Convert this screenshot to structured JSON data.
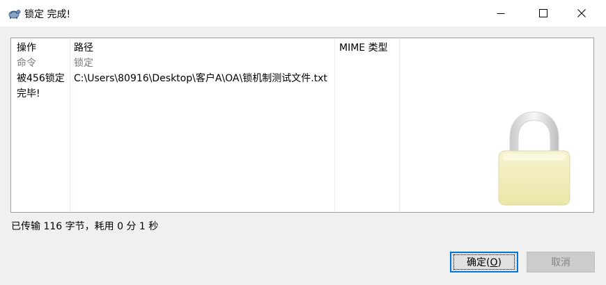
{
  "window": {
    "title": "锁定 完成!",
    "app_icon": "tortoise-icon"
  },
  "table": {
    "columns": [
      "操作",
      "路径",
      "MIME 类型"
    ],
    "rows": [
      {
        "action": "命令",
        "path": "锁定",
        "mime": "",
        "style": "gray"
      },
      {
        "action": "被456锁定完毕!",
        "path": "C:\\Users\\80916\\Desktop\\客户A\\OA\\锁机制测试文件.txt",
        "mime": ""
      }
    ]
  },
  "status": "已传输 116 字节，耗用 0 分 1 秒",
  "buttons": {
    "ok": "确定(O)",
    "ok_accel": "O",
    "cancel": "取消",
    "cancel_disabled": true
  },
  "decor": {
    "lock_icon": "padlock-icon"
  }
}
